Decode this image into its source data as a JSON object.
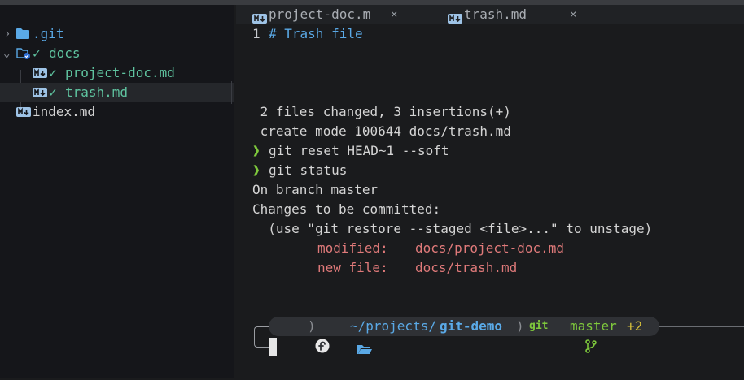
{
  "colors": {
    "background": "#1a1b1d",
    "sidebar_bg": "#15161a",
    "folder_blue": "#5aa9e6",
    "git_green": "#5fc4a0",
    "prompt_green": "#7ec83c",
    "staged_red": "#e07a7a",
    "branch_yellow": "#d8c13a"
  },
  "sidebar": {
    "items": [
      {
        "name": ".git",
        "type": "folder",
        "expanded": false
      },
      {
        "name": "docs",
        "type": "folder",
        "expanded": true,
        "status": "✓"
      },
      {
        "name": "project-doc.md",
        "type": "markdown",
        "status": "✓"
      },
      {
        "name": "trash.md",
        "type": "markdown",
        "status": "✓",
        "selected": true
      },
      {
        "name": "index.md",
        "type": "markdown"
      }
    ]
  },
  "tabs": [
    {
      "label": "project-doc.m",
      "icon": "markdown-icon",
      "close": "×"
    },
    {
      "label": "trash.md",
      "icon": "markdown-icon",
      "close": "×"
    }
  ],
  "editor": {
    "line_number": "1",
    "line_text": "# Trash file"
  },
  "terminal": {
    "lines": [
      " 2 files changed, 3 insertions(+)",
      " create mode 100644 docs/trash.md"
    ],
    "prompt_symbol": "❱",
    "cmd1": "git reset HEAD~1 --soft",
    "cmd2": "git status",
    "status": [
      "On branch master",
      "Changes to be committed:",
      "  (use \"git restore --staged <file>...\" to unstage)"
    ],
    "staged": [
      {
        "kind": "modified:",
        "file": "docs/project-doc.md"
      },
      {
        "kind": "new file:",
        "file": "docs/trash.md"
      }
    ]
  },
  "powerline": {
    "os_icon": "fedora-icon",
    "path_prefix": "~/projects/",
    "path_current": "git-demo",
    "git_label": "git",
    "branch": "master",
    "changes": "+2"
  }
}
